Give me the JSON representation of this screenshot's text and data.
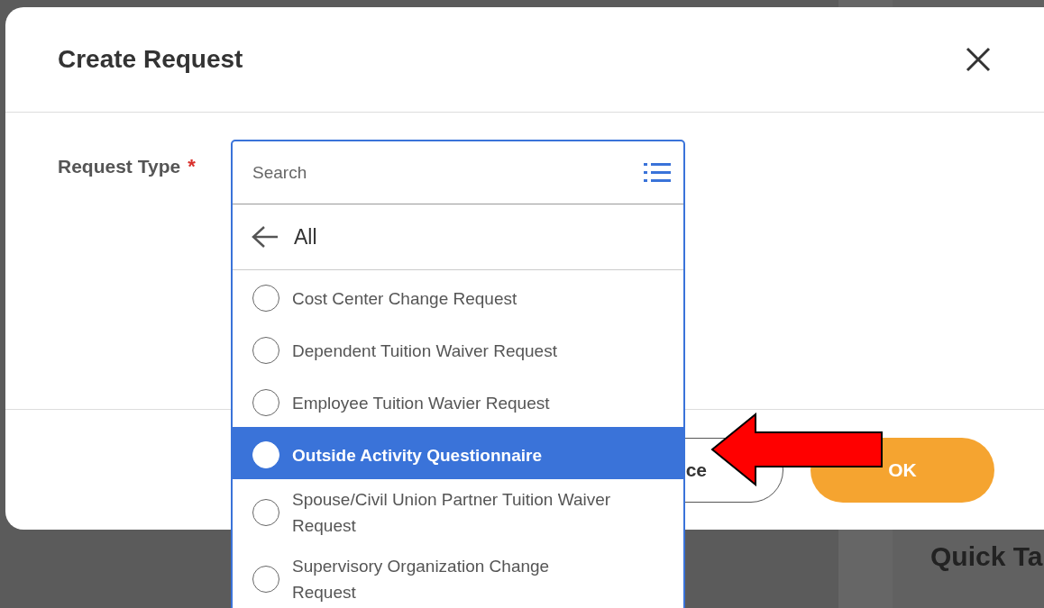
{
  "background": {
    "heading": "Quick Ta"
  },
  "dialog": {
    "title": "Create Request",
    "field": {
      "label": "Request Type",
      "required": true,
      "required_mark": "*"
    },
    "buttons": [
      {
        "kind": "secondary",
        "label": "ce"
      },
      {
        "kind": "primary",
        "label": "OK"
      }
    ]
  },
  "dropdown": {
    "placeholder": "Search",
    "breadcrumb": "All",
    "options": [
      {
        "label": "Cost Center Change Request",
        "selected": false
      },
      {
        "label": "Dependent Tuition Waiver Request",
        "selected": false
      },
      {
        "label": "Employee Tuition Wavier Request",
        "selected": false
      },
      {
        "label": "Outside Activity Questionnaire",
        "selected": true
      },
      {
        "label": "Spouse/Civil Union Partner Tuition Waiver Request",
        "selected": false
      },
      {
        "label": "Supervisory Organization Change Request",
        "selected": false
      }
    ]
  }
}
